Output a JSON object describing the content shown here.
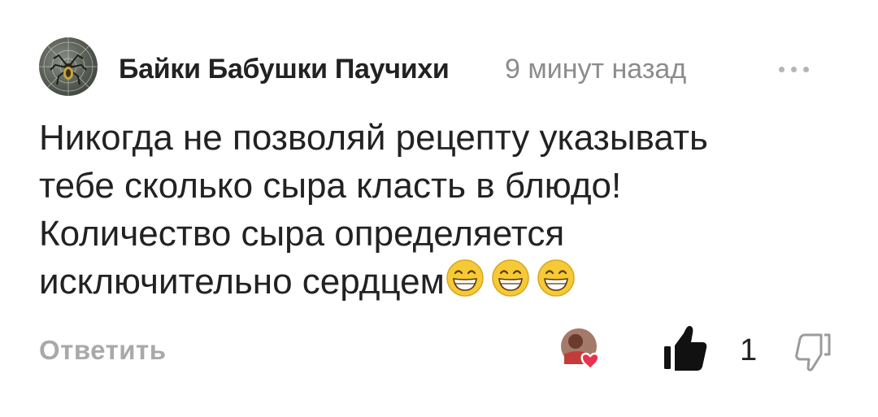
{
  "comment": {
    "author": "Байки Бабушки Паучихи",
    "timestamp": "9 минут назад",
    "lines": [
      "Никогда не позволяй рецепту указывать",
      "тебе сколько сыра класть в блюдо!",
      "Количество сыра определяется",
      "исключительно сердцем"
    ],
    "emojis": [
      "grinning-face-emoji",
      "grinning-face-emoji",
      "grinning-face-emoji"
    ],
    "reply_label": "Ответить",
    "like_count": "1"
  },
  "icons": {
    "more": "more-dots-icon",
    "like": "thumbs-up-icon",
    "dislike": "thumbs-down-icon",
    "reaction": "heart-reaction-avatar"
  },
  "colors": {
    "meta_gray": "#8c8c8c",
    "reply_gray": "#a9a9a9",
    "heart": "#e8324e",
    "emoji_yellow": "#f6c937"
  }
}
